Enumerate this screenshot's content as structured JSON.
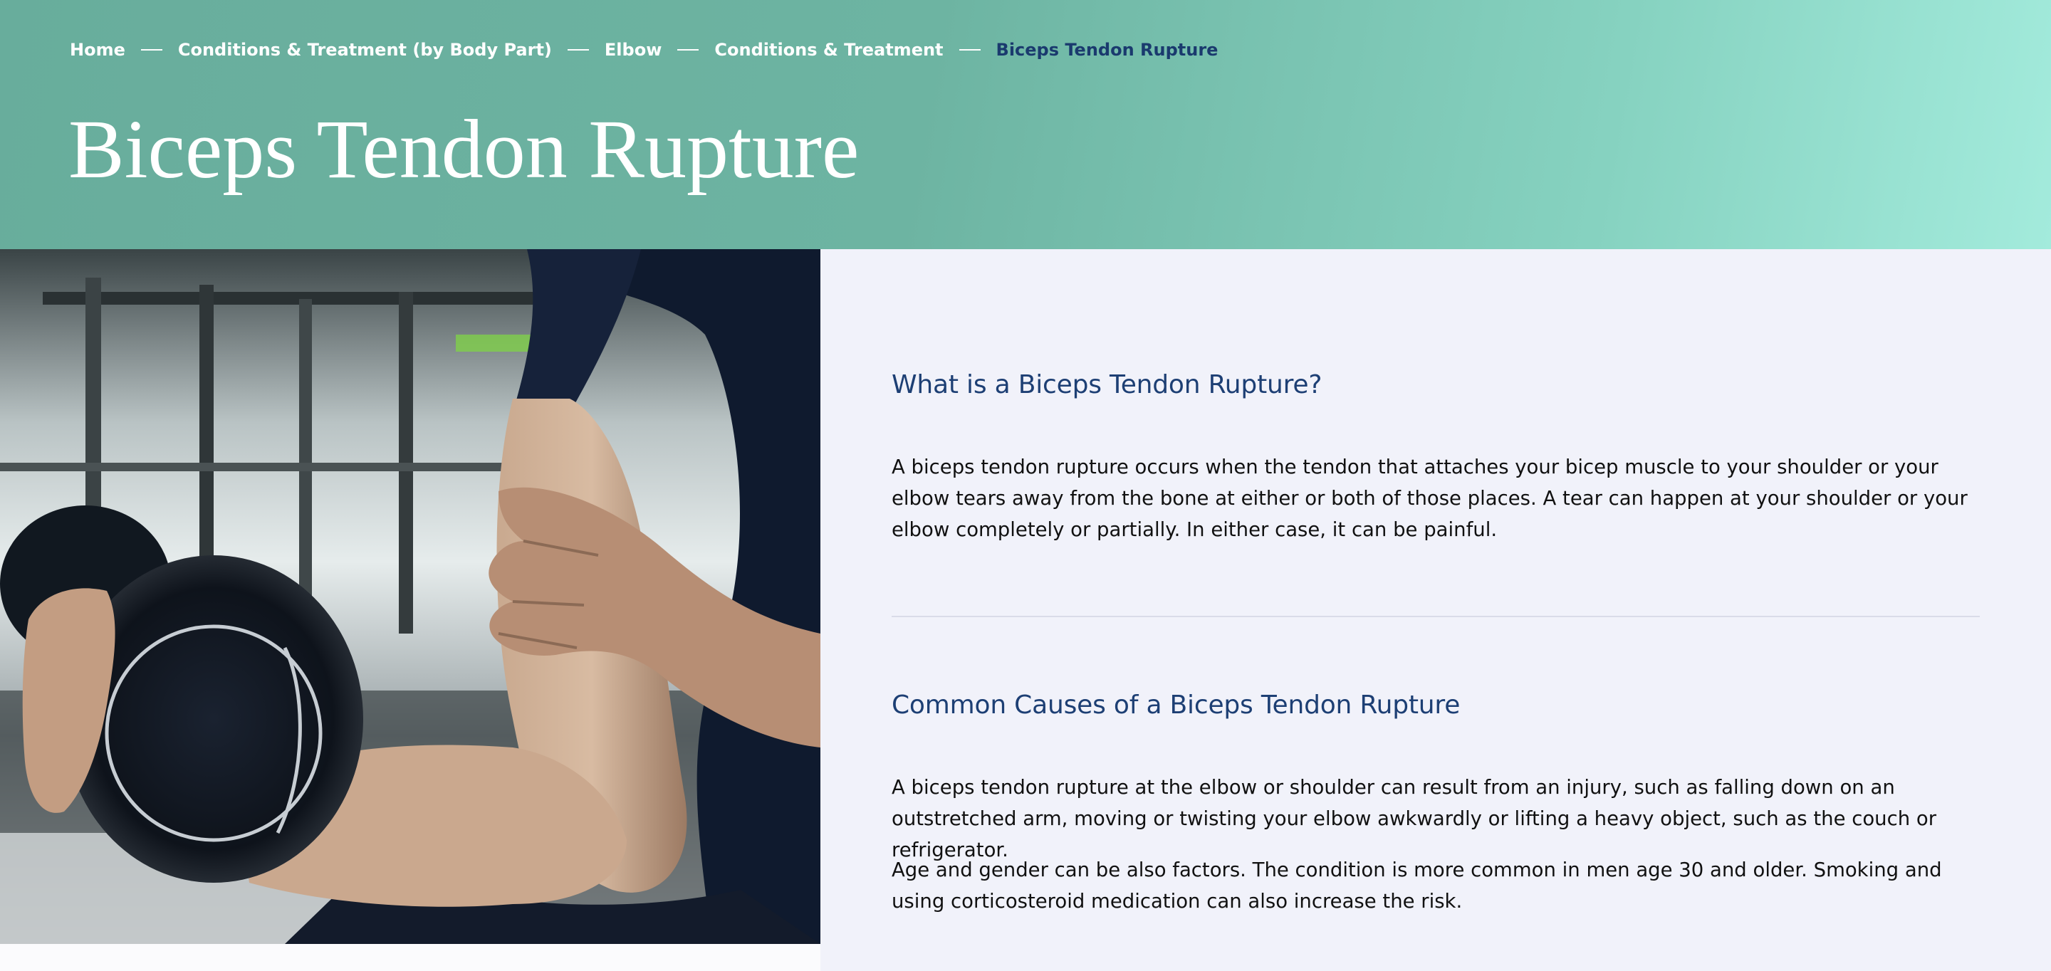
{
  "breadcrumb": [
    {
      "label": "Home"
    },
    {
      "label": "Conditions & Treatment (by Body Part)"
    },
    {
      "label": "Elbow"
    },
    {
      "label": "Conditions & Treatment"
    },
    {
      "label": "Biceps Tendon Rupture"
    }
  ],
  "page": {
    "title": "Biceps Tendon Rupture"
  },
  "colors": {
    "hero_gradient_start": "#68ad9c",
    "hero_gradient_end": "#a3ebdc",
    "heading": "#1d3f74",
    "breadcrumb_current": "#1a3a6e",
    "content_bg": "#f1f2fa"
  },
  "sections": [
    {
      "heading": "What is a Biceps Tendon Rupture?",
      "paragraphs": [
        "A biceps tendon rupture occurs when the tendon that attaches your bicep muscle to your shoulder or your elbow tears away from the bone at either or both of those places. A tear can happen at your shoulder or your elbow completely or partially. In either case, it can be painful."
      ]
    },
    {
      "heading": "Common Causes of a Biceps Tendon Rupture",
      "paragraphs": [
        "A biceps tendon rupture at the elbow or shoulder can result from an injury, such as falling down on an outstretched arm, moving or twisting your elbow awkwardly or lifting a heavy object, such as the couch or refrigerator.",
        "Age and gender can be also factors. The condition is more common in men age 30 and older. Smoking and using corticosteroid medication can also increase the risk."
      ]
    }
  ]
}
